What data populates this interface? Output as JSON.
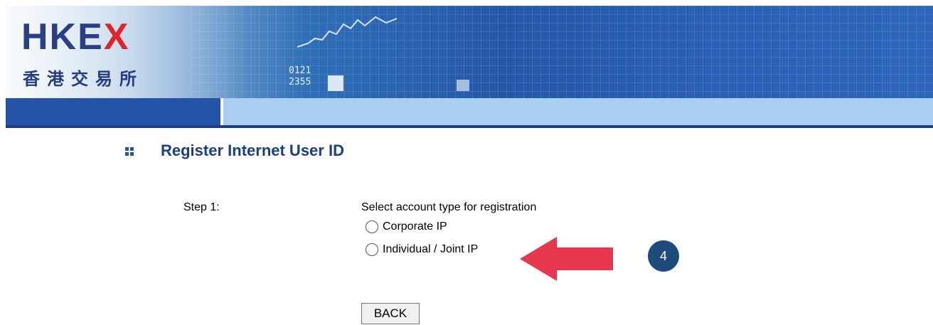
{
  "header": {
    "logo_latin_prefix": "HKE",
    "logo_latin_x": "X",
    "logo_chinese": "香港交易所",
    "ticker_line1": "0121",
    "ticker_line2": "2355",
    "accent_color": "#e0232b",
    "brand_color": "#2b3f88"
  },
  "page": {
    "title": "Register Internet User ID",
    "step_label": "Step 1:",
    "instruction": "Select account type for registration",
    "options": [
      {
        "label": "Corporate IP",
        "selected": false
      },
      {
        "label": "Individual / Joint IP",
        "selected": false
      }
    ],
    "back_label": "BACK"
  },
  "annotation": {
    "badge_number": "4",
    "arrow_color": "#e8384f",
    "badge_color": "#1f4b7a"
  }
}
